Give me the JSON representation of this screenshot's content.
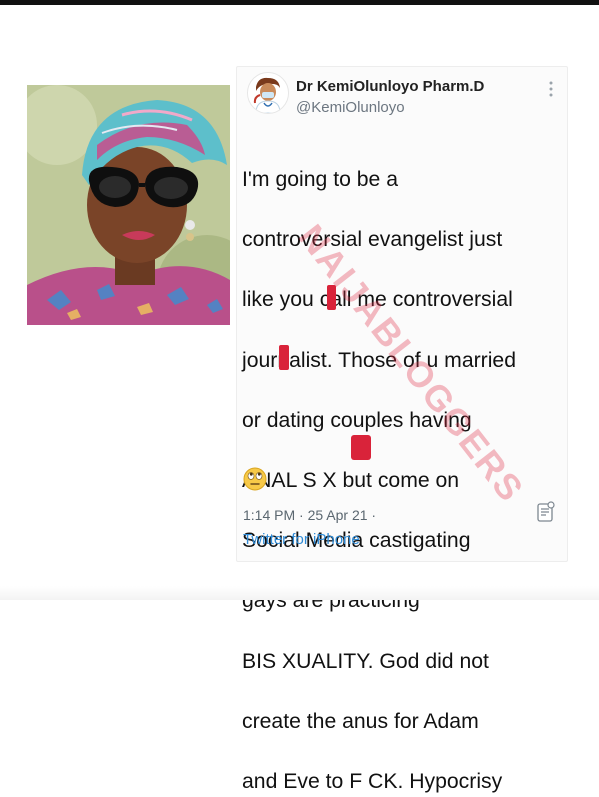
{
  "tweet": {
    "display_name": "Dr KemiOlunloyo Pharm.D",
    "handle": "@KemiOlunloyo",
    "text_lines": [
      "I'm going to be a",
      "controversial evangelist just",
      "like you call me controversial",
      "journalist. Those of u married",
      "or dating couples having",
      "ANAL S X but come on",
      "Social Media castigating",
      "gays are practicing",
      "BIS XUALITY. God did not",
      "create the anus for Adam",
      "and Eve to F  CK. Hypocrisy"
    ],
    "emoji_icon": "rolling-eyes-emoji",
    "timestamp": "1:14 PM · 25 Apr 21 ·",
    "source": "Twitter for iPhone"
  },
  "watermark_text": "NAIJABLOGGERS",
  "colors": {
    "link": "#2f8bd6",
    "meta": "#5b6770",
    "censor_mark": "#d9233a",
    "watermark": "#e0304a"
  },
  "icons": {
    "more": "more-vertical-icon",
    "analytics": "tweet-analytics-icon",
    "avatar": "doctor-avatar-icon"
  }
}
